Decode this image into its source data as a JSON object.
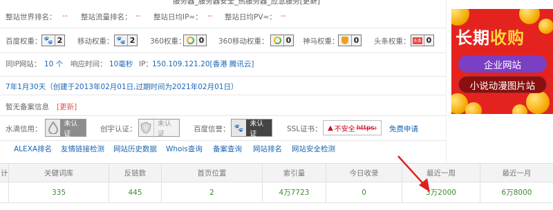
{
  "top_title": "服务器_服务器安全_热服务器_应急服务[更新]",
  "rank_row": [
    {
      "label": "整站世界排名：",
      "value": "--"
    },
    {
      "label": "整站流量排名：",
      "value": "--"
    },
    {
      "label": "整站日均IP≈：",
      "value": "--"
    },
    {
      "label": "整站日均PV≈：",
      "value": "--"
    }
  ],
  "weights": [
    {
      "label": "百度权重：",
      "icon": "paw-icon",
      "value": "2"
    },
    {
      "label": "移动权重：",
      "icon": "paw-icon",
      "value": "2"
    },
    {
      "label": "360权重：",
      "icon": "ring-icon",
      "value": "0"
    },
    {
      "label": "360移动权重：",
      "icon": "ring-icon",
      "value": "0"
    },
    {
      "label": "神马权重：",
      "icon": "medal-icon",
      "value": "0"
    },
    {
      "label": "头条权重：",
      "icon": "toutiao-icon",
      "value": "0"
    }
  ],
  "toutiao_icon_text": "头条",
  "server": {
    "same_ip_label": "同IP网站：",
    "same_ip_value": "10 个",
    "response_label": "响应时间：",
    "response_value": "10毫秒",
    "ip_label": "IP：",
    "ip_value": "150.109.121.20[香港 腾讯云]"
  },
  "domain_age": "7年1月30天（创建于2013年02月01日,过期时间为2021年02月01日）",
  "beian": {
    "text": "暂无备案信息",
    "update": "[更新]"
  },
  "trust": [
    {
      "label": "水滴信用：",
      "icon": "water-drop-icon",
      "badge": "未认证"
    },
    {
      "label": "创宇认证：",
      "icon": "shield-v-icon",
      "badge": "未认证"
    },
    {
      "label": "百度信誉：",
      "icon": "paw-icon",
      "badge": "未认证"
    }
  ],
  "ssl": {
    "label": "SSL证书：",
    "warn": "不安全",
    "https": "https:",
    "apply": "免费申请"
  },
  "tabs": [
    "ALEXA排名",
    "友情链接检测",
    "网站历史数据",
    "Whois查询",
    "备案查询",
    "网站排名",
    "网站安全检测"
  ],
  "table": {
    "headers": [
      "计",
      "关键词库",
      "反链数",
      "首页位置",
      "索引量",
      "今日收录",
      "最近一周",
      "最近一月"
    ],
    "values": [
      "",
      "335",
      "445",
      "2",
      "4万7723",
      "0",
      "3万2000",
      "6万8000"
    ]
  },
  "ad": {
    "title_a": "长期",
    "title_b": "收购",
    "btn1": "企业网站",
    "btn2": "小说动漫图片站",
    "colors": {
      "bg": "#e4231f",
      "gold": "#ffd53a",
      "purple": "#7b3fc4",
      "dark": "#8a1010"
    }
  },
  "annotation_arrow_color": "#e02020"
}
